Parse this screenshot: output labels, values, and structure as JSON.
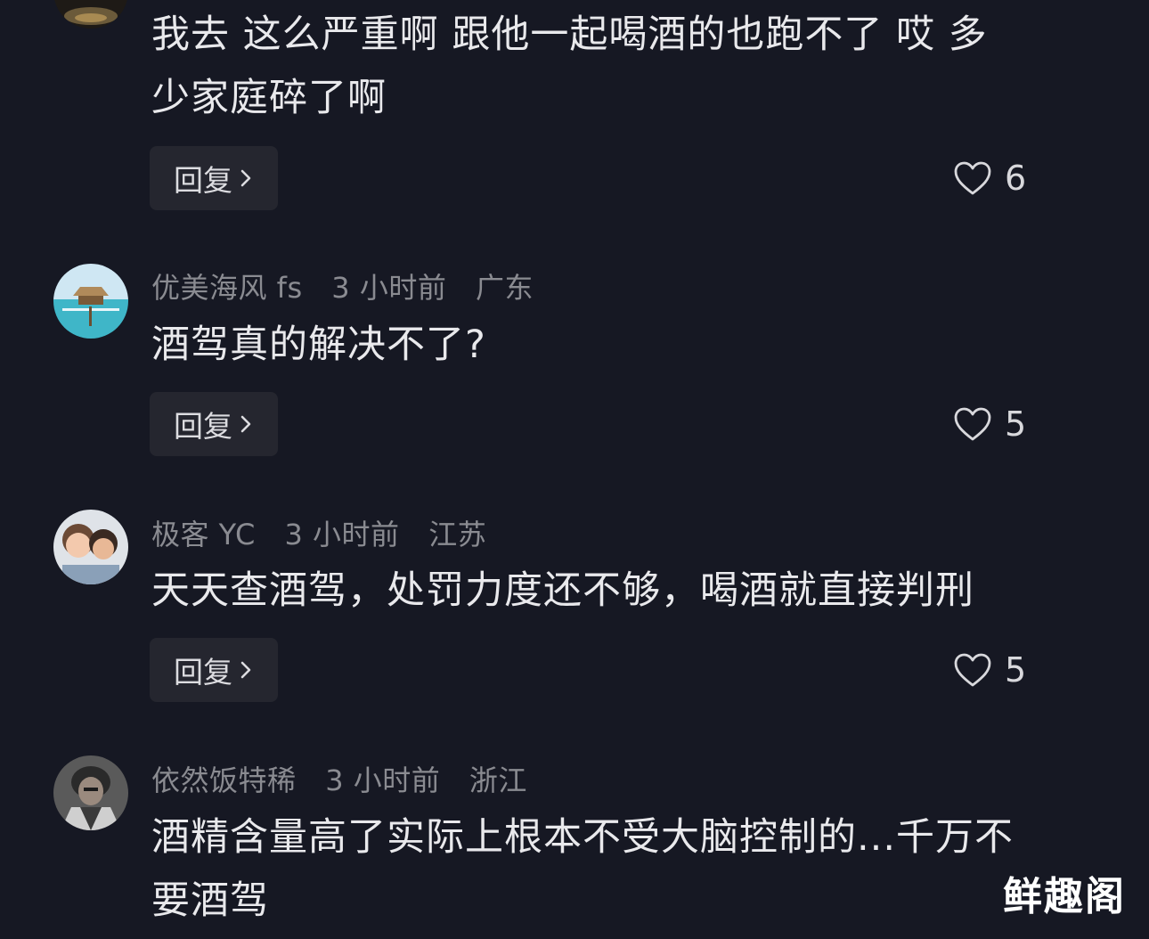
{
  "comments": [
    {
      "username": "",
      "time": "",
      "location": "",
      "text_line1": "我去 这么严重啊 跟他一起喝酒的也跑不了 哎 多",
      "text_line2": "少家庭碎了啊",
      "reply_label": "回复",
      "likes": "6"
    },
    {
      "username": "优美海风 fs",
      "time": "3 小时前",
      "location": "广东",
      "text_line1": "酒驾真的解决不了?",
      "reply_label": "回复",
      "likes": "5"
    },
    {
      "username": "极客 YC",
      "time": "3 小时前",
      "location": "江苏",
      "text_line1": "天天查酒驾，处罚力度还不够，喝酒就直接判刑",
      "reply_label": "回复",
      "likes": "5"
    },
    {
      "username": "依然饭特稀",
      "time": "3 小时前",
      "location": "浙江",
      "text_line1": "酒精含量高了实际上根本不受大脑控制的...千万不",
      "text_line2": "要酒驾"
    }
  ],
  "watermark": "鲜趣阁",
  "colors": {
    "background": "#161823",
    "text": "#e9e9ec",
    "meta": "#8a8b91",
    "reply_bg": "#25262f"
  },
  "icons": {
    "like": "heart-outline-icon",
    "reply_chevron": "chevron-right-icon"
  }
}
